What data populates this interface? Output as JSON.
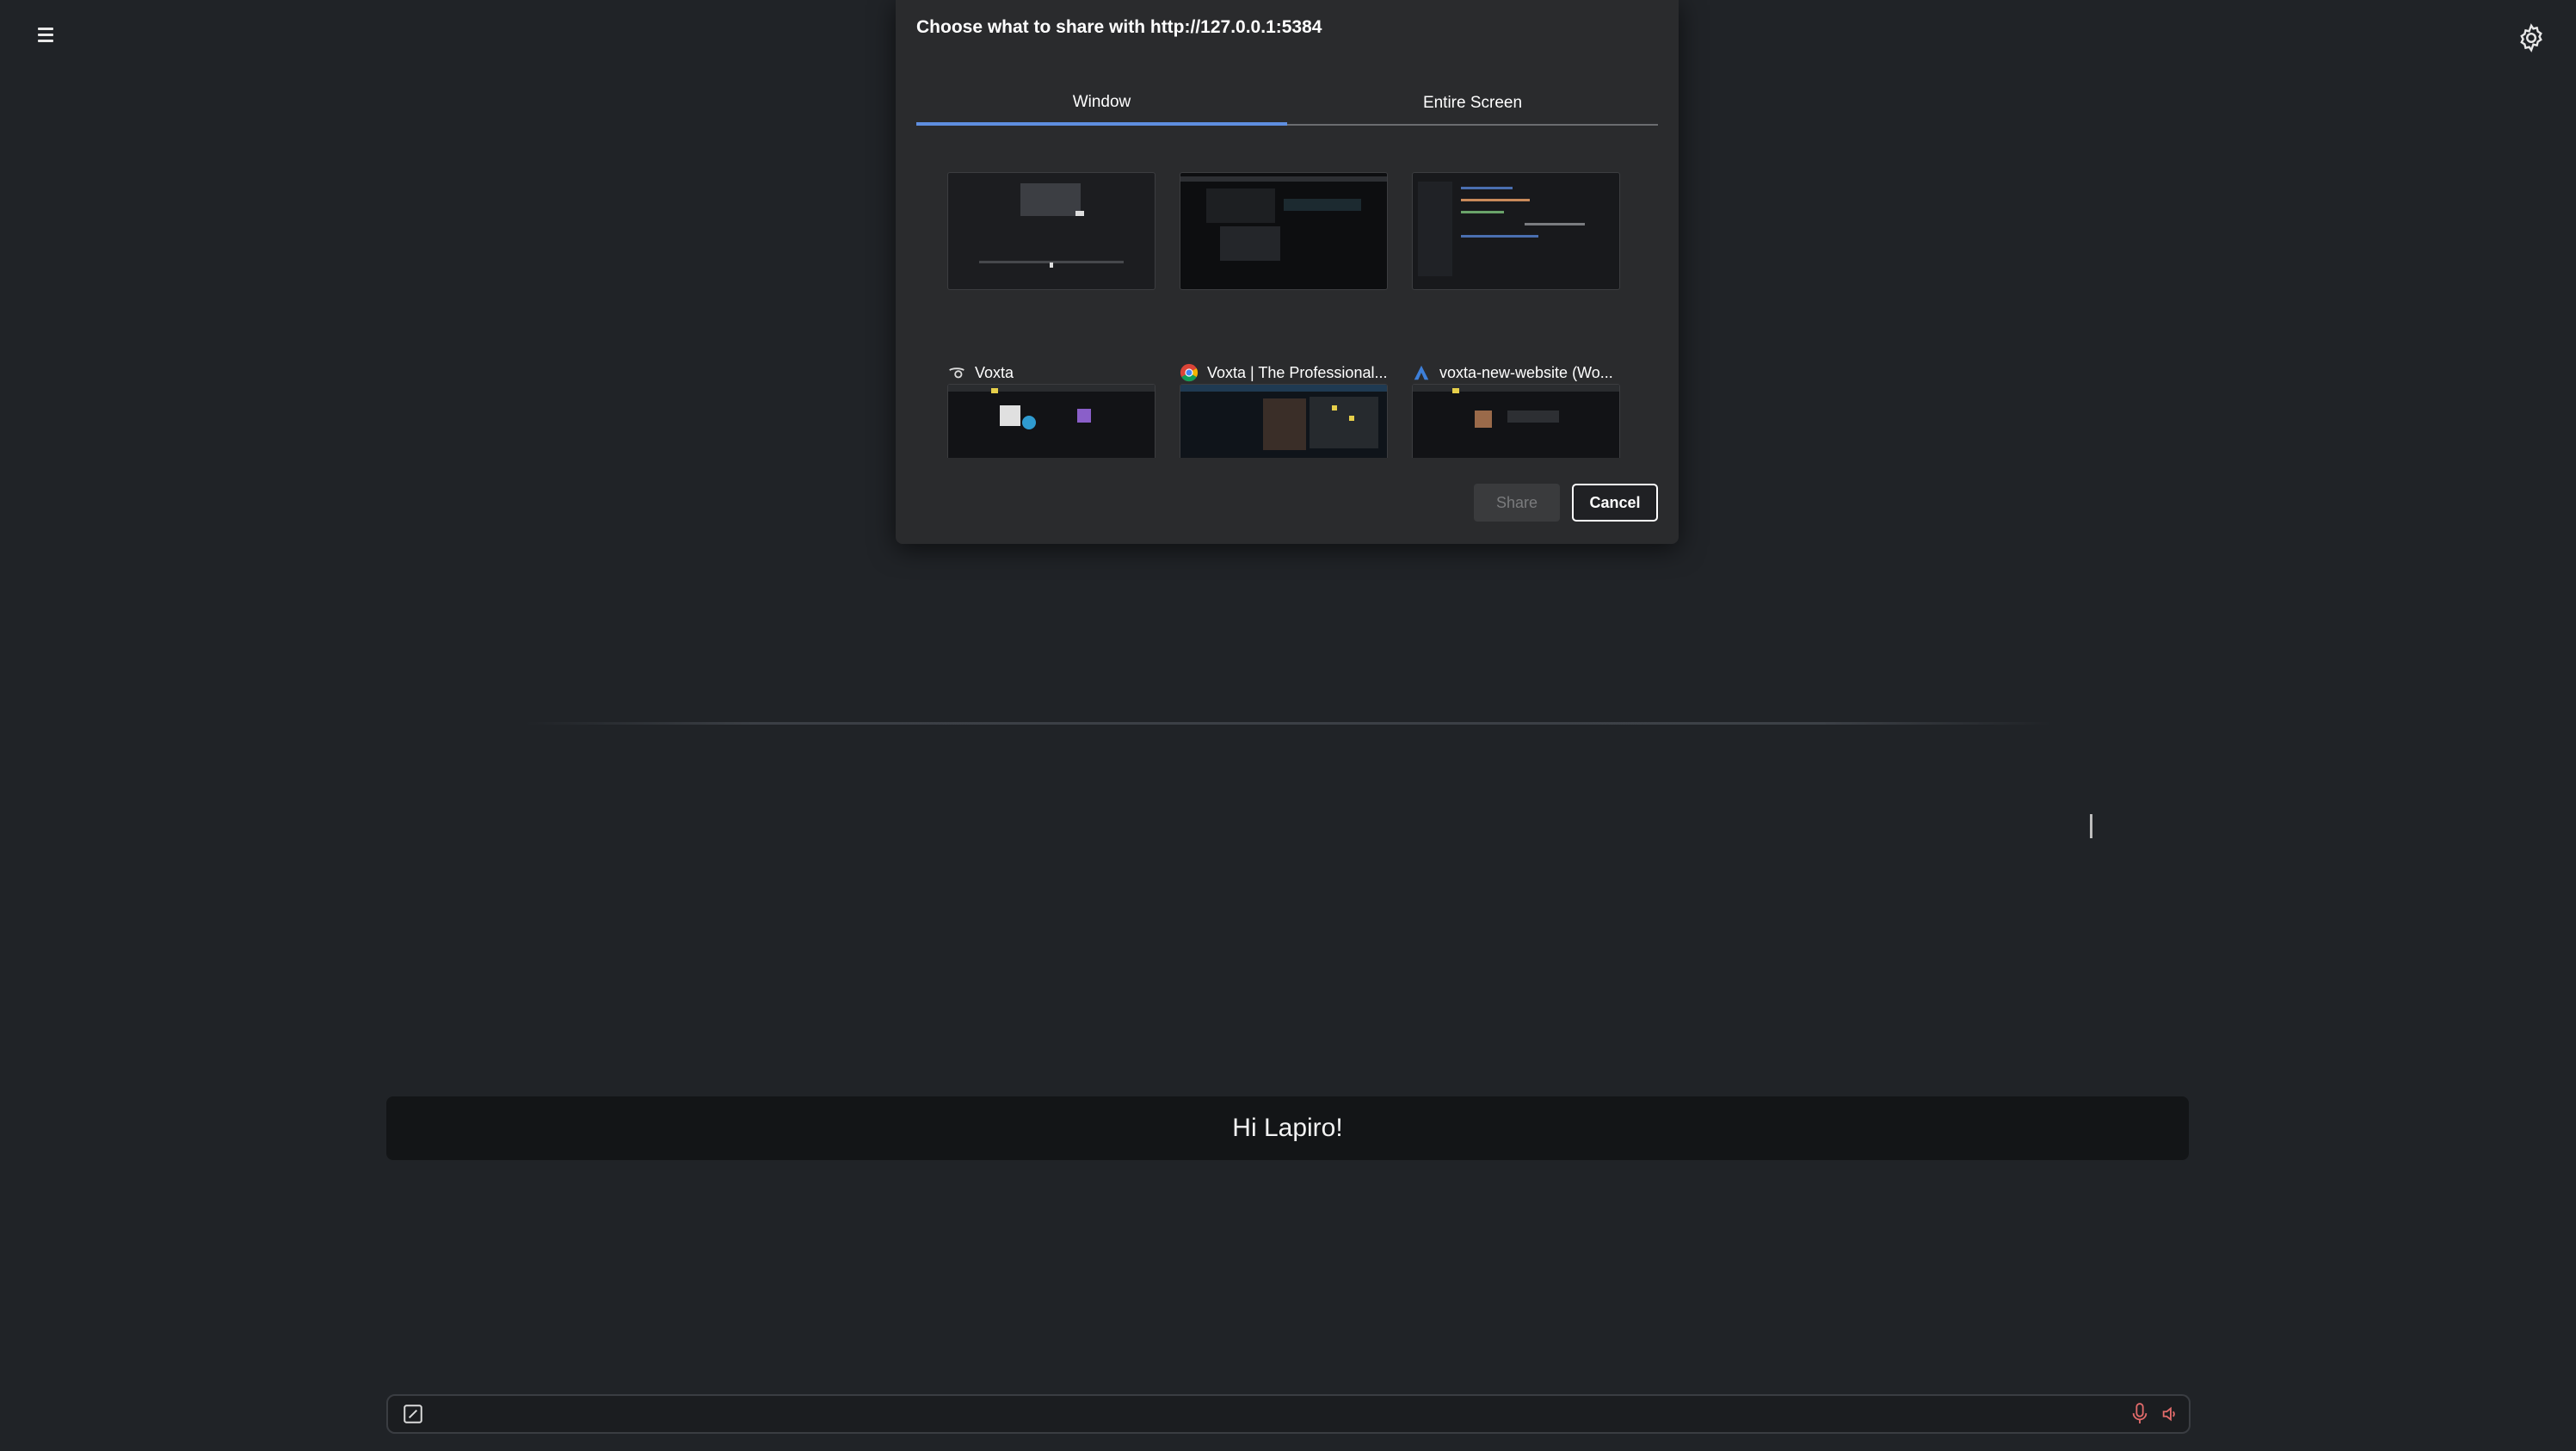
{
  "dialog": {
    "title": "Choose what to share with http://127.0.0.1:5384",
    "tabs": [
      {
        "label": "Window",
        "selected": true
      },
      {
        "label": "Entire Screen",
        "selected": false
      }
    ],
    "windows": [
      {
        "label": "Voxta",
        "icon": "voxta-app-icon"
      },
      {
        "label": "Voxta | The Professional...",
        "icon": "chrome-icon"
      },
      {
        "label": "voxta-new-website (Wo...",
        "icon": "webstorm-icon"
      },
      {
        "label": "",
        "icon": ""
      },
      {
        "label": "",
        "icon": ""
      },
      {
        "label": "",
        "icon": ""
      }
    ],
    "share_label": "Share",
    "cancel_label": "Cancel"
  },
  "chat": {
    "greeting": "Hi Lapiro!",
    "input_value": "",
    "input_placeholder": ""
  },
  "colors": {
    "background": "#202327",
    "dialog": "#2a2b2d",
    "tab_accent": "#5f8fe0",
    "mic": "#e26b6b"
  }
}
